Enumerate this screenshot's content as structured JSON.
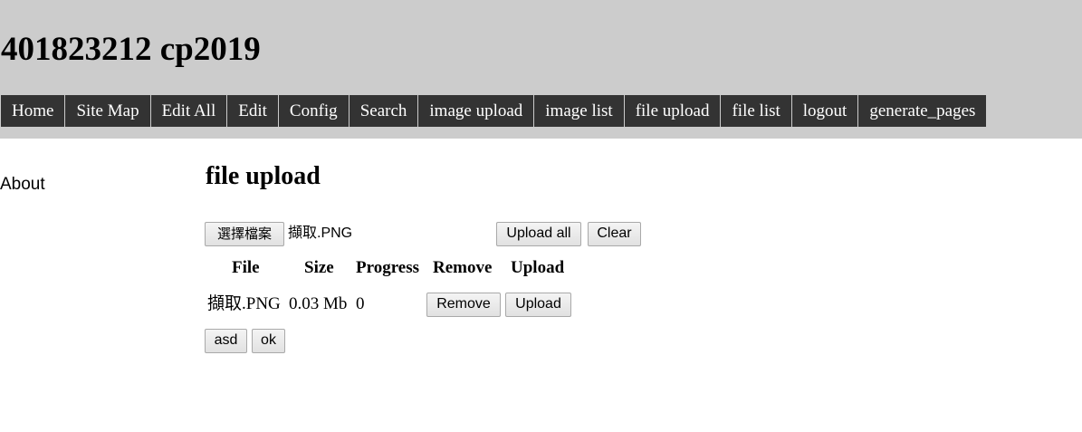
{
  "site": {
    "title": "401823212 cp2019"
  },
  "nav": {
    "items": [
      "Home",
      "Site Map",
      "Edit All",
      "Edit",
      "Config",
      "Search",
      "image upload",
      "image list",
      "file upload",
      "file list",
      "logout",
      "generate_pages"
    ]
  },
  "sidebar": {
    "links": [
      "About"
    ]
  },
  "main": {
    "title": "file upload",
    "file_input": {
      "button_label": "選擇檔案",
      "chosen_file": "擷取.PNG"
    },
    "upload_all_label": "Upload all",
    "clear_label": "Clear",
    "table": {
      "headers": [
        "File",
        "Size",
        "Progress",
        "Remove",
        "Upload"
      ],
      "rows": [
        {
          "file": "擷取.PNG",
          "size": "0.03 Mb",
          "progress": "0",
          "remove_label": "Remove",
          "upload_label": "Upload"
        }
      ]
    },
    "asd_label": "asd",
    "ok_label": "ok"
  }
}
